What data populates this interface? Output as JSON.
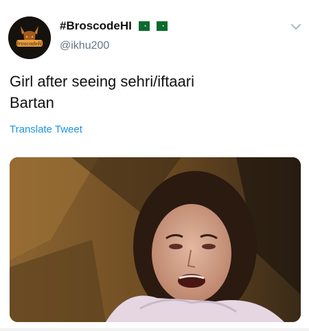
{
  "tweet": {
    "display_name": "#BroscodeHI",
    "handle": "@ikhu200",
    "text_line_1": "Girl after seeing sehri/iftaari",
    "text_line_2": "Bartan",
    "translate_label": "Translate Tweet",
    "avatar_text": "BroscodeHI",
    "flags": [
      "pakistan-flag-icon",
      "pakistan-flag-icon"
    ]
  },
  "icons": {
    "more": "chevron-down-icon",
    "flag": "pakistan-flag-icon"
  },
  "colors": {
    "link": "#1b95e0",
    "handle": "#657786",
    "text": "#111111",
    "flag_green": "#0b6b2e"
  }
}
